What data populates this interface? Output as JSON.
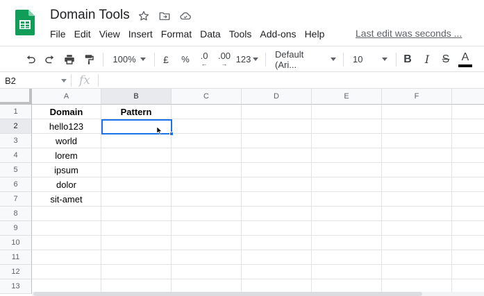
{
  "app": {
    "doc_title": "Domain Tools",
    "last_edit": "Last edit was seconds ...",
    "logo_icon": "sheets-logo-icon",
    "brand_color": "#0F9D58"
  },
  "menu": {
    "items": [
      "File",
      "Edit",
      "View",
      "Insert",
      "Format",
      "Data",
      "Tools",
      "Add-ons",
      "Help"
    ]
  },
  "toolbar": {
    "zoom": "100%",
    "currency": "£",
    "percent": "%",
    "decrease_decimal": ".0",
    "increase_decimal": ".00",
    "number_format": "123",
    "font_family": "Default (Ari...",
    "font_size": "10",
    "bold": "B",
    "italic": "I",
    "strike": "S",
    "text_color": "A"
  },
  "formula_bar": {
    "cell_ref": "B2",
    "fx": "fx",
    "value": ""
  },
  "grid": {
    "columns": [
      "A",
      "B",
      "C",
      "D",
      "E",
      "F"
    ],
    "rows": [
      "1",
      "2",
      "3",
      "4",
      "5",
      "6",
      "7",
      "8",
      "9",
      "10",
      "11",
      "12",
      "13"
    ],
    "selected_cell": "B2",
    "cells": {
      "A1": "Domain",
      "B1": "Pattern",
      "A2": "hello123",
      "A3": "world",
      "A4": "lorem",
      "A5": "ipsum",
      "A6": "dolor",
      "A7": "sit-amet"
    },
    "selection_color": "#1a73e8"
  }
}
